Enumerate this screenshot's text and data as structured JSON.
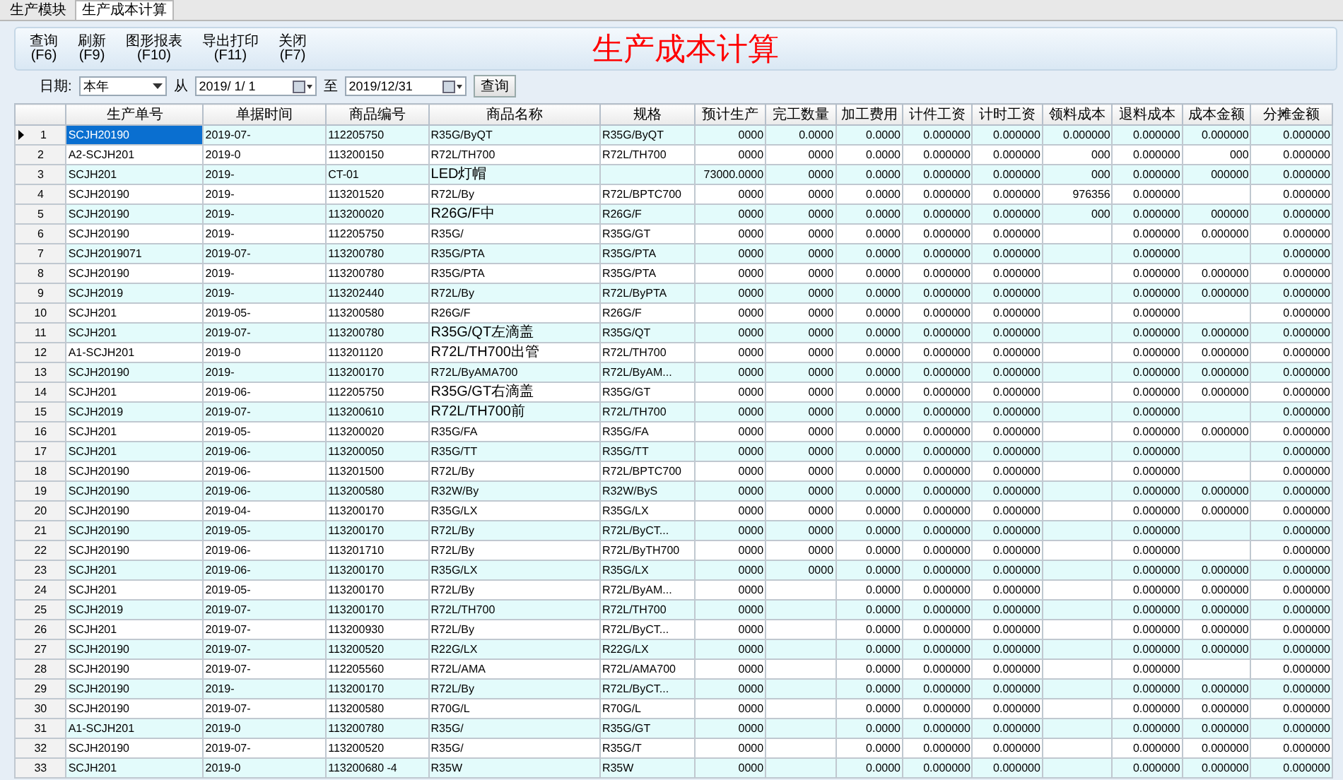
{
  "tabs": [
    {
      "label": "生产模块",
      "selected": false
    },
    {
      "label": "生产成本计算",
      "selected": true
    }
  ],
  "toolbar": [
    {
      "label": "查询",
      "key": "(F6)"
    },
    {
      "label": "刷新",
      "key": "(F9)"
    },
    {
      "label": "图形报表",
      "key": "(F10)"
    },
    {
      "label": "导出打印",
      "key": "(F11)"
    },
    {
      "label": "关闭",
      "key": "(F7)"
    }
  ],
  "title": "生产成本计算",
  "filter": {
    "date_label": "日期:",
    "period": "本年",
    "from_label": "从",
    "from": "2019/ 1/ 1",
    "to_label": "至",
    "to": "2019/12/31",
    "button": "查询"
  },
  "table": {
    "columns": [
      {
        "label": "生产单号",
        "kind": "text"
      },
      {
        "label": "单据时间",
        "kind": "text"
      },
      {
        "label": "商品编号",
        "kind": "text"
      },
      {
        "label": "商品名称",
        "kind": "text"
      },
      {
        "label": "规格",
        "kind": "text"
      },
      {
        "label": "预计生产",
        "kind": "number"
      },
      {
        "label": "完工数量",
        "kind": "number"
      },
      {
        "label": "加工费用",
        "kind": "number"
      },
      {
        "label": "计件工资",
        "kind": "number"
      },
      {
        "label": "计时工资",
        "kind": "number"
      },
      {
        "label": "领料成本",
        "kind": "number"
      },
      {
        "label": "退料成本",
        "kind": "number"
      },
      {
        "label": "成本金额",
        "kind": "number"
      },
      {
        "label": "分摊金额",
        "kind": "number"
      }
    ],
    "rows": [
      {
        "no": "1",
        "selected": true,
        "cells": [
          "SCJH20190",
          "2019-07-",
          "112205750",
          "R35G/ByQT",
          "R35G/ByQT",
          "0000",
          "0.0000",
          "0.0000",
          "0.000000",
          "0.000000",
          "0.000000",
          "0.000000",
          "0.000000",
          "0.000000"
        ]
      },
      {
        "no": "2",
        "selected": false,
        "cells": [
          "A2-SCJH201",
          "2019-0",
          "113200150",
          "R72L/TH700",
          "R72L/TH700",
          "0000",
          "0000",
          "0.0000",
          "0.000000",
          "0.000000",
          "000",
          "0.000000",
          "000",
          "0.000000"
        ]
      },
      {
        "no": "3",
        "selected": false,
        "cells": [
          "SCJH201",
          "2019-",
          "CT-01",
          "LED灯帽",
          "",
          "73000.0000",
          "0000",
          "0.0000",
          "0.000000",
          "0.000000",
          "000",
          "0.000000",
          "000000",
          "0.000000"
        ]
      },
      {
        "no": "4",
        "selected": false,
        "cells": [
          "SCJH20190",
          "2019-",
          "113201520",
          "R72L/By",
          "R72L/BPTC700",
          "0000",
          "0000",
          "0.0000",
          "0.000000",
          "0.000000",
          "976356",
          "0.000000",
          "",
          "0.000000"
        ]
      },
      {
        "no": "5",
        "selected": false,
        "cells": [
          "SCJH20190",
          "2019-",
          "113200020",
          "R26G/F中",
          "R26G/F",
          "0000",
          "0000",
          "0.0000",
          "0.000000",
          "0.000000",
          "000",
          "0.000000",
          "000000",
          "0.000000"
        ]
      },
      {
        "no": "6",
        "selected": false,
        "cells": [
          "SCJH20190",
          "2019-",
          "112205750",
          "R35G/",
          "R35G/GT",
          "0000",
          "0000",
          "0.0000",
          "0.000000",
          "0.000000",
          "",
          "0.000000",
          "0.000000",
          "0.000000"
        ]
      },
      {
        "no": "7",
        "selected": false,
        "cells": [
          "SCJH2019071",
          "2019-07-",
          "113200780",
          "R35G/PTA",
          "R35G/PTA",
          "0000",
          "0000",
          "0.0000",
          "0.000000",
          "0.000000",
          "",
          "0.000000",
          "",
          "0.000000"
        ]
      },
      {
        "no": "8",
        "selected": false,
        "cells": [
          "SCJH20190",
          "2019-",
          "113200780",
          "R35G/PTA",
          "R35G/PTA",
          "0000",
          "0000",
          "0.0000",
          "0.000000",
          "0.000000",
          "",
          "0.000000",
          "0.000000",
          "0.000000"
        ]
      },
      {
        "no": "9",
        "selected": false,
        "cells": [
          "SCJH2019",
          "2019-",
          "113202440",
          "R72L/By",
          "R72L/ByPTA",
          "0000",
          "0000",
          "0.0000",
          "0.000000",
          "0.000000",
          "",
          "0.000000",
          "0.000000",
          "0.000000"
        ]
      },
      {
        "no": "10",
        "selected": false,
        "cells": [
          "SCJH201",
          "2019-05-",
          "113200580",
          "R26G/F",
          "R26G/F",
          "0000",
          "0000",
          "0.0000",
          "0.000000",
          "0.000000",
          "",
          "0.000000",
          "",
          "0.000000"
        ]
      },
      {
        "no": "11",
        "selected": false,
        "cells": [
          "SCJH201",
          "2019-07-",
          "113200780",
          "R35G/QT左滴盖",
          "R35G/QT",
          "0000",
          "0000",
          "0.0000",
          "0.000000",
          "0.000000",
          "",
          "0.000000",
          "0.000000",
          "0.000000"
        ]
      },
      {
        "no": "12",
        "selected": false,
        "cells": [
          "A1-SCJH201",
          "2019-0",
          "113201120",
          "R72L/TH700出管",
          "R72L/TH700",
          "0000",
          "0000",
          "0.0000",
          "0.000000",
          "0.000000",
          "",
          "0.000000",
          "0.000000",
          "0.000000"
        ]
      },
      {
        "no": "13",
        "selected": false,
        "cells": [
          "SCJH20190",
          "2019-",
          "113200170",
          "R72L/ByAMA700",
          "R72L/ByAM...",
          "0000",
          "0000",
          "0.0000",
          "0.000000",
          "0.000000",
          "",
          "0.000000",
          "0.000000",
          "0.000000"
        ]
      },
      {
        "no": "14",
        "selected": false,
        "cells": [
          "SCJH201",
          "2019-06-",
          "112205750",
          "R35G/GT右滴盖",
          "R35G/GT",
          "0000",
          "0000",
          "0.0000",
          "0.000000",
          "0.000000",
          "",
          "0.000000",
          "0.000000",
          "0.000000"
        ]
      },
      {
        "no": "15",
        "selected": false,
        "cells": [
          "SCJH2019",
          "2019-07-",
          "113200610",
          "R72L/TH700前",
          "R72L/TH700",
          "0000",
          "0000",
          "0.0000",
          "0.000000",
          "0.000000",
          "",
          "0.000000",
          "",
          "0.000000"
        ]
      },
      {
        "no": "16",
        "selected": false,
        "cells": [
          "SCJH201",
          "2019-05-",
          "113200020",
          "R35G/FA",
          "R35G/FA",
          "0000",
          "0000",
          "0.0000",
          "0.000000",
          "0.000000",
          "",
          "0.000000",
          "0.000000",
          "0.000000"
        ]
      },
      {
        "no": "17",
        "selected": false,
        "cells": [
          "SCJH201",
          "2019-06-",
          "113200050",
          "R35G/TT",
          "R35G/TT",
          "0000",
          "0000",
          "0.0000",
          "0.000000",
          "0.000000",
          "",
          "0.000000",
          "",
          "0.000000"
        ]
      },
      {
        "no": "18",
        "selected": false,
        "cells": [
          "SCJH20190",
          "2019-06-",
          "113201500",
          "R72L/By",
          "R72L/BPTC700",
          "0000",
          "0000",
          "0.0000",
          "0.000000",
          "0.000000",
          "",
          "0.000000",
          "",
          "0.000000"
        ]
      },
      {
        "no": "19",
        "selected": false,
        "cells": [
          "SCJH20190",
          "2019-06-",
          "113200580",
          "R32W/By",
          "R32W/ByS",
          "0000",
          "0000",
          "0.0000",
          "0.000000",
          "0.000000",
          "",
          "0.000000",
          "0.000000",
          "0.000000"
        ]
      },
      {
        "no": "20",
        "selected": false,
        "cells": [
          "SCJH20190",
          "2019-04-",
          "113200170",
          "R35G/LX",
          "R35G/LX",
          "0000",
          "0000",
          "0.0000",
          "0.000000",
          "0.000000",
          "",
          "0.000000",
          "0.000000",
          "0.000000"
        ]
      },
      {
        "no": "21",
        "selected": false,
        "cells": [
          "SCJH20190",
          "2019-05-",
          "113200170",
          "R72L/By",
          "R72L/ByCT...",
          "0000",
          "0000",
          "0.0000",
          "0.000000",
          "0.000000",
          "",
          "0.000000",
          "",
          "0.000000"
        ]
      },
      {
        "no": "22",
        "selected": false,
        "cells": [
          "SCJH20190",
          "2019-06-",
          "113201710",
          "R72L/By",
          "R72L/ByTH700",
          "0000",
          "0000",
          "0.0000",
          "0.000000",
          "0.000000",
          "",
          "0.000000",
          "",
          "0.000000"
        ]
      },
      {
        "no": "23",
        "selected": false,
        "cells": [
          "SCJH201",
          "2019-06-",
          "113200170",
          "R35G/LX",
          "R35G/LX",
          "0000",
          "0000",
          "0.0000",
          "0.000000",
          "0.000000",
          "",
          "0.000000",
          "0.000000",
          "0.000000"
        ]
      },
      {
        "no": "24",
        "selected": false,
        "cells": [
          "SCJH201",
          "2019-05-",
          "113200170",
          "R72L/By",
          "R72L/ByAM...",
          "0000",
          "",
          "0.0000",
          "0.000000",
          "0.000000",
          "",
          "0.000000",
          "0.000000",
          "0.000000"
        ]
      },
      {
        "no": "25",
        "selected": false,
        "cells": [
          "SCJH2019",
          "2019-07-",
          "113200170",
          "R72L/TH700",
          "R72L/TH700",
          "0000",
          "",
          "0.0000",
          "0.000000",
          "0.000000",
          "",
          "0.000000",
          "0.000000",
          "0.000000"
        ]
      },
      {
        "no": "26",
        "selected": false,
        "cells": [
          "SCJH201",
          "2019-07-",
          "113200930",
          "R72L/By",
          "R72L/ByCT...",
          "0000",
          "",
          "0.0000",
          "0.000000",
          "0.000000",
          "",
          "0.000000",
          "0.000000",
          "0.000000"
        ]
      },
      {
        "no": "27",
        "selected": false,
        "cells": [
          "SCJH20190",
          "2019-07-",
          "113200520",
          "R22G/LX",
          "R22G/LX",
          "0000",
          "",
          "0.0000",
          "0.000000",
          "0.000000",
          "",
          "0.000000",
          "0.000000",
          "0.000000"
        ]
      },
      {
        "no": "28",
        "selected": false,
        "cells": [
          "SCJH20190",
          "2019-07-",
          "112205560",
          "R72L/AMA",
          "R72L/AMA700",
          "0000",
          "",
          "0.0000",
          "0.000000",
          "0.000000",
          "",
          "0.000000",
          "",
          "0.000000"
        ]
      },
      {
        "no": "29",
        "selected": false,
        "cells": [
          "SCJH20190",
          "2019-",
          "113200170",
          "R72L/By",
          "R72L/ByCT...",
          "0000",
          "",
          "0.0000",
          "0.000000",
          "0.000000",
          "",
          "0.000000",
          "0.000000",
          "0.000000"
        ]
      },
      {
        "no": "30",
        "selected": false,
        "cells": [
          "SCJH20190",
          "2019-07-",
          "113200580",
          "R70G/L",
          "R70G/L",
          "0000",
          "",
          "0.0000",
          "0.000000",
          "0.000000",
          "",
          "0.000000",
          "0.000000",
          "0.000000"
        ]
      },
      {
        "no": "31",
        "selected": false,
        "cells": [
          "A1-SCJH201",
          "2019-0",
          "113200780",
          "R35G/",
          "R35G/GT",
          "0000",
          "",
          "0.0000",
          "0.000000",
          "0.000000",
          "",
          "0.000000",
          "0.000000",
          "0.000000"
        ]
      },
      {
        "no": "32",
        "selected": false,
        "cells": [
          "SCJH20190",
          "2019-07-",
          "113200520",
          "R35G/",
          "R35G/T",
          "0000",
          "",
          "0.0000",
          "0.000000",
          "0.000000",
          "",
          "0.000000",
          "0.000000",
          "0.000000"
        ]
      },
      {
        "no": "33",
        "selected": false,
        "cells": [
          "SCJH201",
          "2019-0",
          "113200680 -4",
          "R35W",
          "R35W",
          "0000",
          "",
          "0.0000",
          "0.000000",
          "0.000000",
          "",
          "0.000000",
          "0.000000",
          "0.000000"
        ]
      }
    ]
  }
}
